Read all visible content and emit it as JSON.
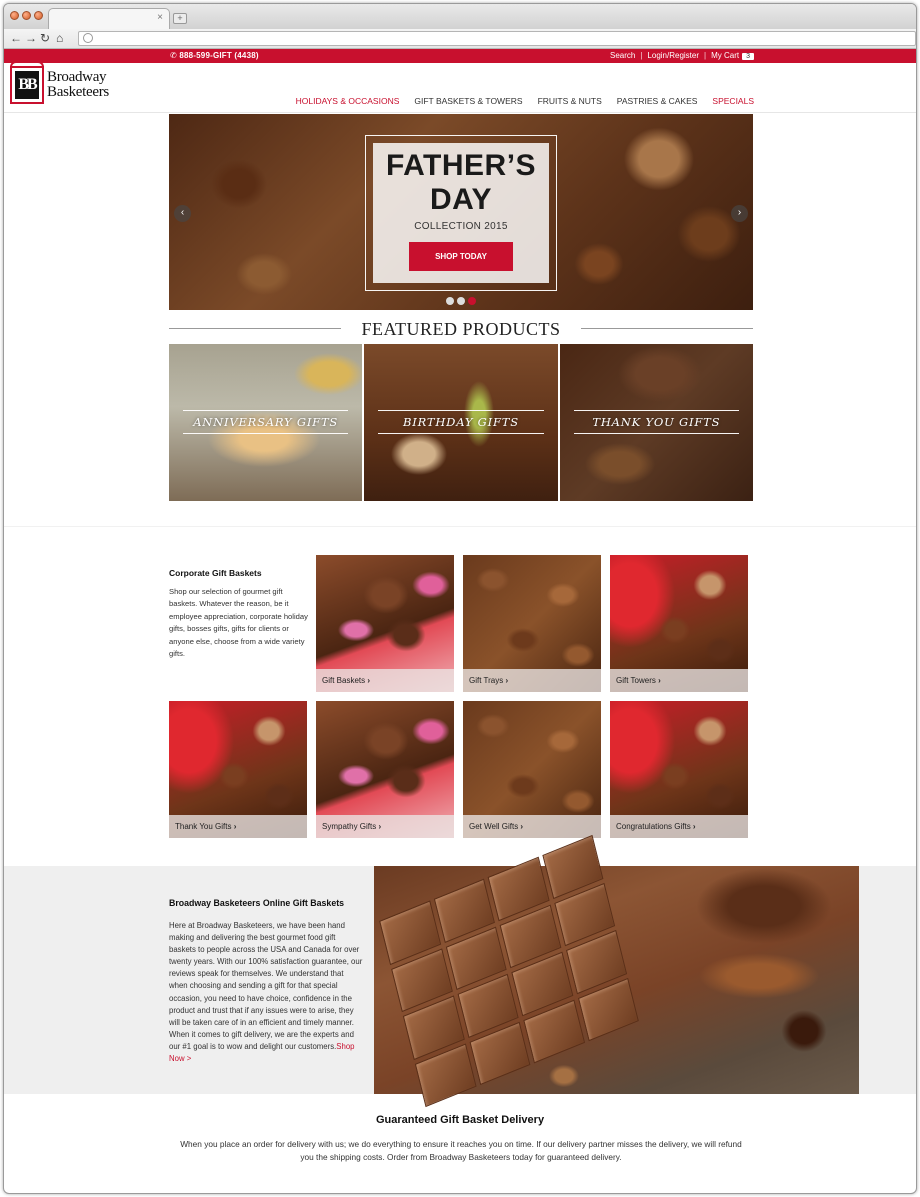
{
  "browser": {
    "tab_close": "×",
    "new_tab": "+"
  },
  "topbar": {
    "phone_icon": "phone-icon",
    "phone": "888-599-GIFT (4438)",
    "search": "Search",
    "login": "Login/Register",
    "cart": "My Cart",
    "cart_count": "3",
    "separator": "|"
  },
  "brand": {
    "monogram": "BB",
    "name_line1": "Broadway",
    "name_line2": "Basketeers"
  },
  "nav": {
    "items": [
      {
        "label": "HOLIDAYS & OCCASIONS"
      },
      {
        "label": "GIFT BASKETS & TOWERS"
      },
      {
        "label": "FRUITS & NUTS"
      },
      {
        "label": "PASTRIES & CAKES"
      },
      {
        "label": "SPECIALS"
      }
    ]
  },
  "hero": {
    "title_line1": "FATHER’S",
    "title_line2": "DAY",
    "subtitle": "COLLECTION 2015",
    "button": "SHOP TODAY",
    "prev": "‹",
    "next": "›"
  },
  "featured": {
    "title": "FEATURED PRODUCTS",
    "items": [
      {
        "label": "ANNIVERSARY GIFTS"
      },
      {
        "label": "BIRTHDAY GIFTS"
      },
      {
        "label": "THANK YOU GIFTS"
      }
    ]
  },
  "corporate": {
    "title": "Corporate Gift Baskets",
    "description": "Shop our selection of gourmet gift baskets. Whatever the reason, be it employee appreciation, corporate holiday gifts, bosses gifts, gifts for clients or anyone else, choose from a wide variety gifts.",
    "tiles": [
      {
        "label": "Gift Baskets"
      },
      {
        "label": "Gift Trays"
      },
      {
        "label": "Gift Towers"
      },
      {
        "label": "Thank You Gifts"
      },
      {
        "label": "Sympathy Gifts"
      },
      {
        "label": "Get Well Gifts"
      },
      {
        "label": "Congratulations Gifts"
      }
    ]
  },
  "about": {
    "title": "Broadway Basketeers Online Gift Baskets",
    "description": "Here at Broadway Basketeers, we have been hand making and delivering the best gourmet food gift baskets to people across the USA and Canada for over twenty years. With our 100% satisfaction guarantee, our reviews speak for themselves. We understand that when choosing and sending a gift for that special occasion, you need to have choice, confidence in the product and trust that if any issues were to arise, they will be taken care of in an efficient and timely manner. When it comes to gift delivery, we are the experts and our #1 goal is to wow and delight our customers.",
    "link": "Shop Now >"
  },
  "guarantee": {
    "title": "Guaranteed Gift Basket Delivery",
    "description": "When you place an order for delivery with us; we do everything to ensure it reaches you on time. If our delivery partner misses the delivery, we will refund you the shipping costs. Order from Broadway Basketeers today for guaranteed delivery."
  },
  "colors": {
    "brand_red": "#c8102e"
  }
}
